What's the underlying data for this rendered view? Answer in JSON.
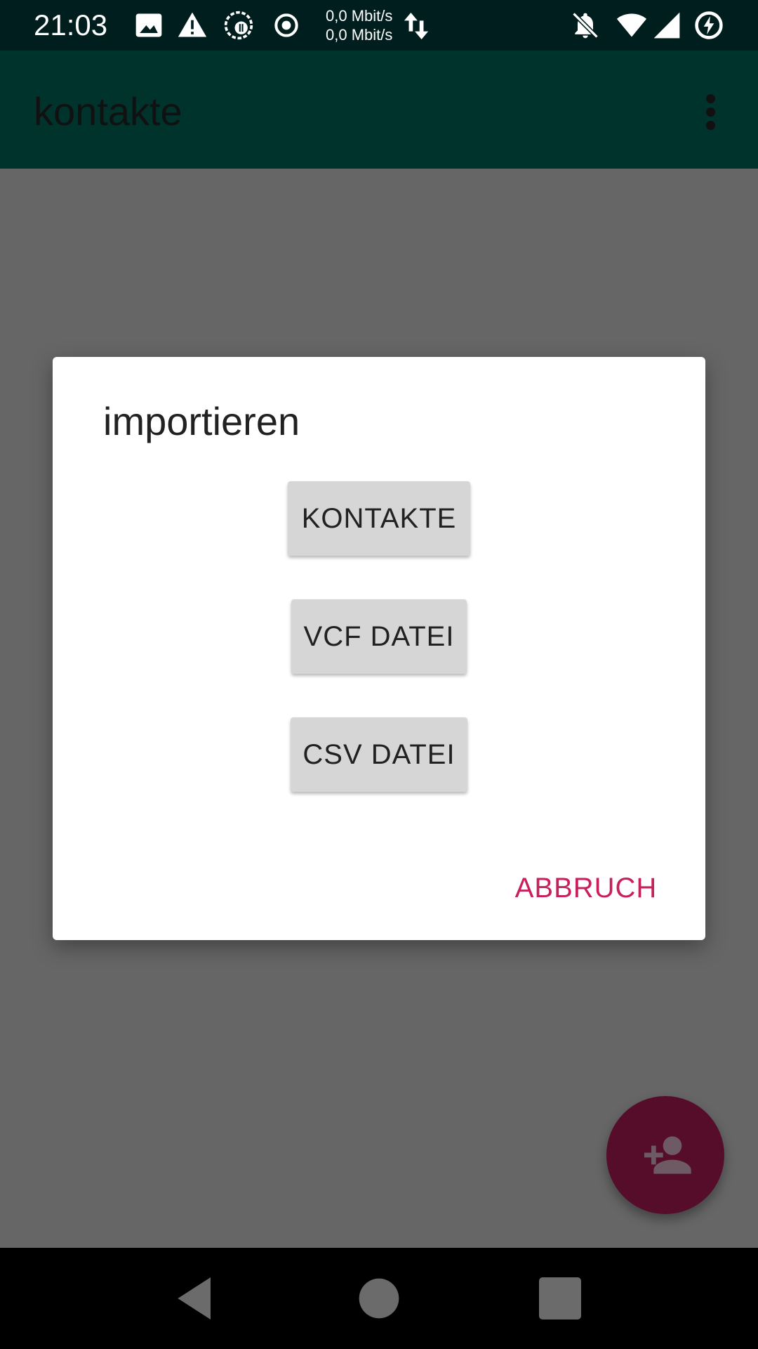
{
  "status_bar": {
    "time": "21:03",
    "net_speed_up": "0,0 Mbit/s",
    "net_speed_down": "0,0 Mbit/s",
    "icons": [
      "image-icon",
      "warning-icon",
      "vpn-icon",
      "record-icon",
      "data-arrows-icon",
      "notifications-off-icon",
      "wifi-icon",
      "signal-icon",
      "battery-charging-icon"
    ]
  },
  "app_bar": {
    "title": "kontakte",
    "menu_icon": "overflow-menu-icon"
  },
  "dialog": {
    "title": "importieren",
    "buttons": [
      {
        "label": "KONTAKTE"
      },
      {
        "label": "VCF DATEI"
      },
      {
        "label": "CSV DATEI"
      }
    ],
    "cancel_label": "ABBRUCH"
  },
  "fab": {
    "icon": "add-person-icon"
  },
  "nav_bar": {
    "icons": [
      "back-icon",
      "home-icon",
      "recents-icon"
    ]
  },
  "colors": {
    "status_bar": "#001e1e",
    "app_bar": "#01332d",
    "scrim": "#666666",
    "accent": "#c8205c",
    "fab": "#560d2a"
  }
}
